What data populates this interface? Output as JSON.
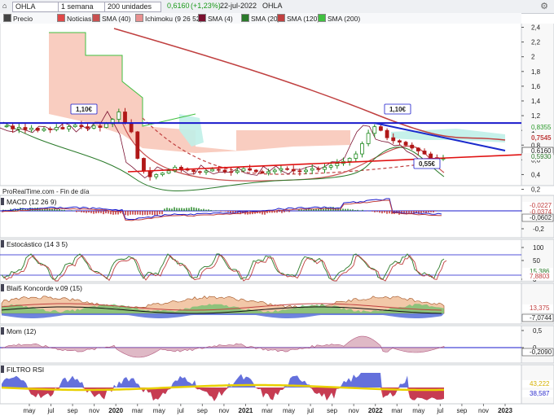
{
  "toolbar": {
    "icon": "home-icon",
    "ticker": "OHLA",
    "period": "1 semana",
    "units": "200 unidades",
    "price": "0,6160",
    "change": "(+1,23%)",
    "date": "22-jul-2022",
    "name": "OHLA"
  },
  "legend": {
    "items": [
      {
        "label": "Precio",
        "color": "#444444"
      },
      {
        "label": "Noticias",
        "color": "#e04848"
      },
      {
        "label": "SMA (40)",
        "color": "#c85050"
      },
      {
        "label": "Ichimoku (9 26 52)",
        "color": "#e89090"
      },
      {
        "label": "SMA (4)",
        "color": "#7a1030"
      },
      {
        "label": "SMA (20)",
        "color": "#2a7a2a"
      },
      {
        "label": "SMA (120)",
        "color": "#c04040"
      },
      {
        "label": "SMA (200)",
        "color": "#40c040"
      }
    ]
  },
  "source_text": "ProRealTime.com - Fin de día",
  "colors": {
    "up_candle": "#1f8a1f",
    "down_candle": "#b01818",
    "resistance": "#1a1acc",
    "support": "#e01010",
    "downtrend": "#1a2acc",
    "kumo": "#f8c0b0",
    "kumo_green": "#c0f0e8"
  },
  "chart_data": [
    {
      "type": "line",
      "title": "OHLA",
      "ylim": [
        0.25,
        2.45
      ],
      "yticks": [
        "2,4",
        "2,2",
        "2",
        "1,8",
        "1,6",
        "1,4",
        "1,2",
        "1",
        "0,8",
        "0,6",
        "0,4",
        "0,2"
      ],
      "xticks": [
        "may",
        "jul",
        "sep",
        "nov",
        "2020",
        "mar",
        "may",
        "jul",
        "sep",
        "nov",
        "2021",
        "mar",
        "may",
        "jul",
        "sep",
        "nov",
        "2022",
        "mar",
        "may",
        "jul",
        "sep",
        "nov",
        "2023"
      ],
      "annotations": [
        {
          "text": "1,10€",
          "value": 1.1
        },
        {
          "text": "1,10€",
          "value": 1.1
        },
        {
          "text": "0,55€",
          "value": 0.55
        }
      ],
      "price_labels": [
        {
          "text": "0,8355",
          "color": "#2a9a2a"
        },
        {
          "text": "0,7545",
          "color": "#c04040"
        },
        {
          "text": "0,6160",
          "color": "#222222"
        },
        {
          "text": "0,5930",
          "color": "#2a7a2a"
        }
      ],
      "horizontal_line": 1.1,
      "price_series": [
        1.06,
        1.02,
        1.04,
        1.01,
        1.03,
        1.0,
        1.02,
        1.01,
        1.04,
        1.02,
        1.05,
        1.07,
        1.05,
        1.03,
        1.06,
        1.04,
        1.09,
        1.15,
        1.25,
        1.1,
        0.98,
        0.62,
        0.45,
        0.37,
        0.4,
        0.42,
        0.45,
        0.5,
        0.48,
        0.46,
        0.44,
        0.43,
        0.45,
        0.47,
        0.46,
        0.44,
        0.43,
        0.45,
        0.48,
        0.46,
        0.44,
        0.42,
        0.44,
        0.46,
        0.48,
        0.47,
        0.45,
        0.44,
        0.46,
        0.48,
        0.47,
        0.5,
        0.52,
        0.55,
        0.58,
        0.62,
        0.68,
        0.82,
        0.96,
        1.05,
        1.0,
        0.9,
        0.86,
        0.84,
        0.8,
        0.76,
        0.72,
        0.68,
        0.63,
        0.61,
        0.62
      ]
    },
    {
      "type": "line",
      "title": "MACD (12 26 9)",
      "yticks": [
        "0",
        "-0,2"
      ],
      "price_labels": [
        {
          "text": "-0,0227",
          "color": "#c04040"
        },
        {
          "text": "-0,0374",
          "color": "#c04040"
        },
        {
          "text": "-0,0602",
          "color": "#222222"
        }
      ]
    },
    {
      "type": "line",
      "title": "Estocástico (14 3 5)",
      "yticks": [
        "100",
        "50",
        "0"
      ],
      "price_labels": [
        {
          "text": "15,386",
          "color": "#2a7a2a"
        },
        {
          "text": "7,8803",
          "color": "#c04040"
        }
      ]
    },
    {
      "type": "area",
      "title": "Blai5 Koncorde v.09 (15)",
      "price_labels": [
        {
          "text": "13,375",
          "color": "#c04040"
        },
        {
          "text": "-7,0744",
          "color": "#222222"
        }
      ]
    },
    {
      "type": "area",
      "title": "Mom (12)",
      "yticks": [
        "0,5",
        "0"
      ],
      "price_labels": [
        {
          "text": "-0,2090",
          "color": "#222222"
        }
      ]
    },
    {
      "type": "area",
      "title": "FILTRO RSI",
      "price_labels": [
        {
          "text": "43,222",
          "color": "#d4b000"
        },
        {
          "text": "38,587",
          "color": "#2a2acc"
        }
      ]
    }
  ]
}
